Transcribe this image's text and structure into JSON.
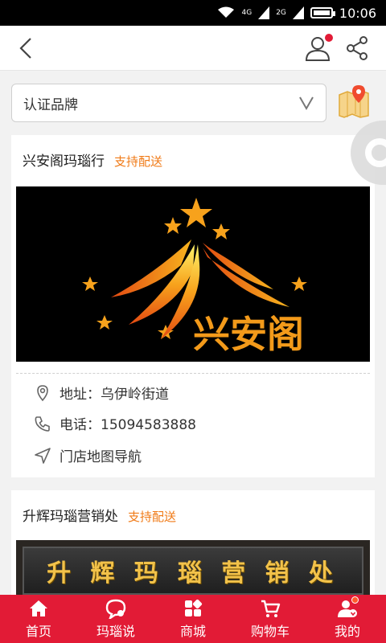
{
  "status_bar": {
    "time": "10:06",
    "network_1": "4G",
    "network_2": "2G",
    "icons": [
      "wifi-icon",
      "signal-icon",
      "signal-icon",
      "battery-icon"
    ]
  },
  "header": {
    "icons": [
      "back-arrow-icon",
      "user-icon",
      "share-icon"
    ]
  },
  "filter": {
    "label": "认证品牌",
    "icons": [
      "chevron-down-icon",
      "map-pin-icon"
    ]
  },
  "stores": [
    {
      "name": "兴安阁玛瑙行",
      "delivery": "支持配送",
      "logo_text": "兴安阁",
      "address_label": "地址：乌伊岭街道",
      "phone_label": "电话：15094583888",
      "navigation_label": "门店地图导航"
    },
    {
      "name": "升辉玛瑙营销处",
      "delivery": "支持配送",
      "sign_text": [
        "升",
        "辉",
        "玛",
        "瑙",
        "营",
        "销",
        "处"
      ]
    }
  ],
  "bottom_nav": {
    "items": [
      {
        "label": "首页",
        "icon": "home-icon"
      },
      {
        "label": "玛瑙说",
        "icon": "chat-icon"
      },
      {
        "label": "商城",
        "icon": "grid-icon"
      },
      {
        "label": "购物车",
        "icon": "cart-icon"
      },
      {
        "label": "我的",
        "icon": "profile-icon"
      }
    ]
  },
  "colors": {
    "brand_red": "#e21b36",
    "delivery_orange": "#f07a16",
    "logo_gold": "#f39a1a"
  }
}
